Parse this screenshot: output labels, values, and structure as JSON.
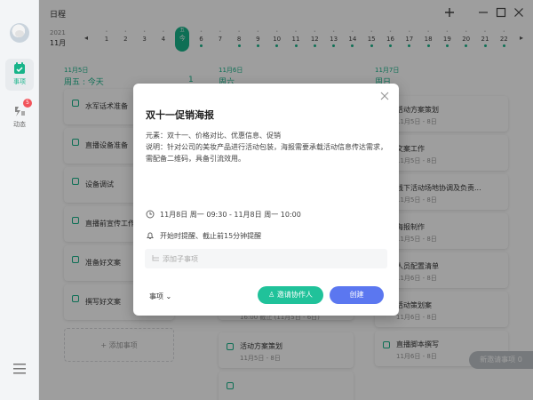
{
  "app": {
    "title": "日程"
  },
  "sidebar": {
    "items": [
      {
        "label": "事项"
      },
      {
        "label": "动态",
        "badge": "5"
      }
    ]
  },
  "date_strip": {
    "year": "2021",
    "month": "11月",
    "days": [
      {
        "dot": "•",
        "num": "1"
      },
      {
        "dot": "•",
        "num": "2"
      },
      {
        "dot": "•",
        "num": "3"
      },
      {
        "dot": "•",
        "num": "4"
      },
      {
        "dot": "五",
        "num": "今",
        "today": true
      },
      {
        "dot": "•",
        "num": "6"
      },
      {
        "dot": "•",
        "num": "7"
      },
      {
        "dot": "•",
        "num": "8"
      },
      {
        "dot": "•",
        "num": "9"
      },
      {
        "dot": "•",
        "num": "10"
      },
      {
        "dot": "•",
        "num": "11"
      },
      {
        "dot": "•",
        "num": "12"
      },
      {
        "dot": "•",
        "num": "13"
      },
      {
        "dot": "•",
        "num": "14"
      },
      {
        "dot": "•",
        "num": "15"
      },
      {
        "dot": "•",
        "num": "16"
      },
      {
        "dot": "•",
        "num": "17"
      },
      {
        "dot": "•",
        "num": "18"
      },
      {
        "dot": "•",
        "num": "19"
      },
      {
        "dot": "•",
        "num": "20"
      },
      {
        "dot": "•",
        "num": "21"
      },
      {
        "dot": "•",
        "num": "22"
      }
    ]
  },
  "columns": [
    {
      "date": "11月5日",
      "title": "周五 : 今天",
      "count": "1",
      "cards": [
        {
          "title": "水军话术准备",
          "time": ""
        },
        {
          "title": "直播设备准备",
          "time": ""
        },
        {
          "title": "设备调试",
          "time": ""
        },
        {
          "title": "直播前宣传工作",
          "time": ""
        },
        {
          "title": "准备好文案",
          "time": ""
        },
        {
          "title": "撰写好文案",
          "time": ""
        }
      ],
      "add_label": "+ 添加事项"
    },
    {
      "date": "11月6日",
      "title": "周六",
      "cards": [
        {
          "title": "",
          "time": "16:00 截止 (11月5日 - 6日)"
        },
        {
          "title": "活动方案策划",
          "time": "11月5日 - 8日"
        },
        {
          "title": "",
          "time": ""
        }
      ]
    },
    {
      "date": "11月7日",
      "title": "周日",
      "cards": [
        {
          "title": "活动方案策划",
          "time": "11月5日 - 8日"
        },
        {
          "title": "文案工作",
          "time": "11月5日 - 8日"
        },
        {
          "title": "线下活动场地协调及负责...",
          "time": "11月5日 - 8日"
        },
        {
          "title": "海报制作",
          "time": "11月5日 - 8日"
        },
        {
          "title": "人员配置清单",
          "time": "11月6日 - 8日"
        },
        {
          "title": "活动策划案",
          "time": "11月6日 - 8日"
        },
        {
          "title": "直播脚本撰写",
          "time": "11月6日 - 8日"
        }
      ]
    }
  ],
  "new_event": "新邀请事项 0",
  "modal": {
    "title": "双十一促销海报",
    "desc": "元素：双十一、价格对比、优惠信息、促销\n说明：针对公司的美妆产品进行活动包装，海报需要承载活动信息传达需求，需配备二维码，具备引流效用。",
    "time": "11月8日 周一 09:30 - 11月8日 周一 10:00",
    "reminder": "开始时提醒、截止前15分钟提醒",
    "sub_placeholder": "添加子事项",
    "type": "事项",
    "invite": "邀请协作人",
    "create": "创建"
  }
}
